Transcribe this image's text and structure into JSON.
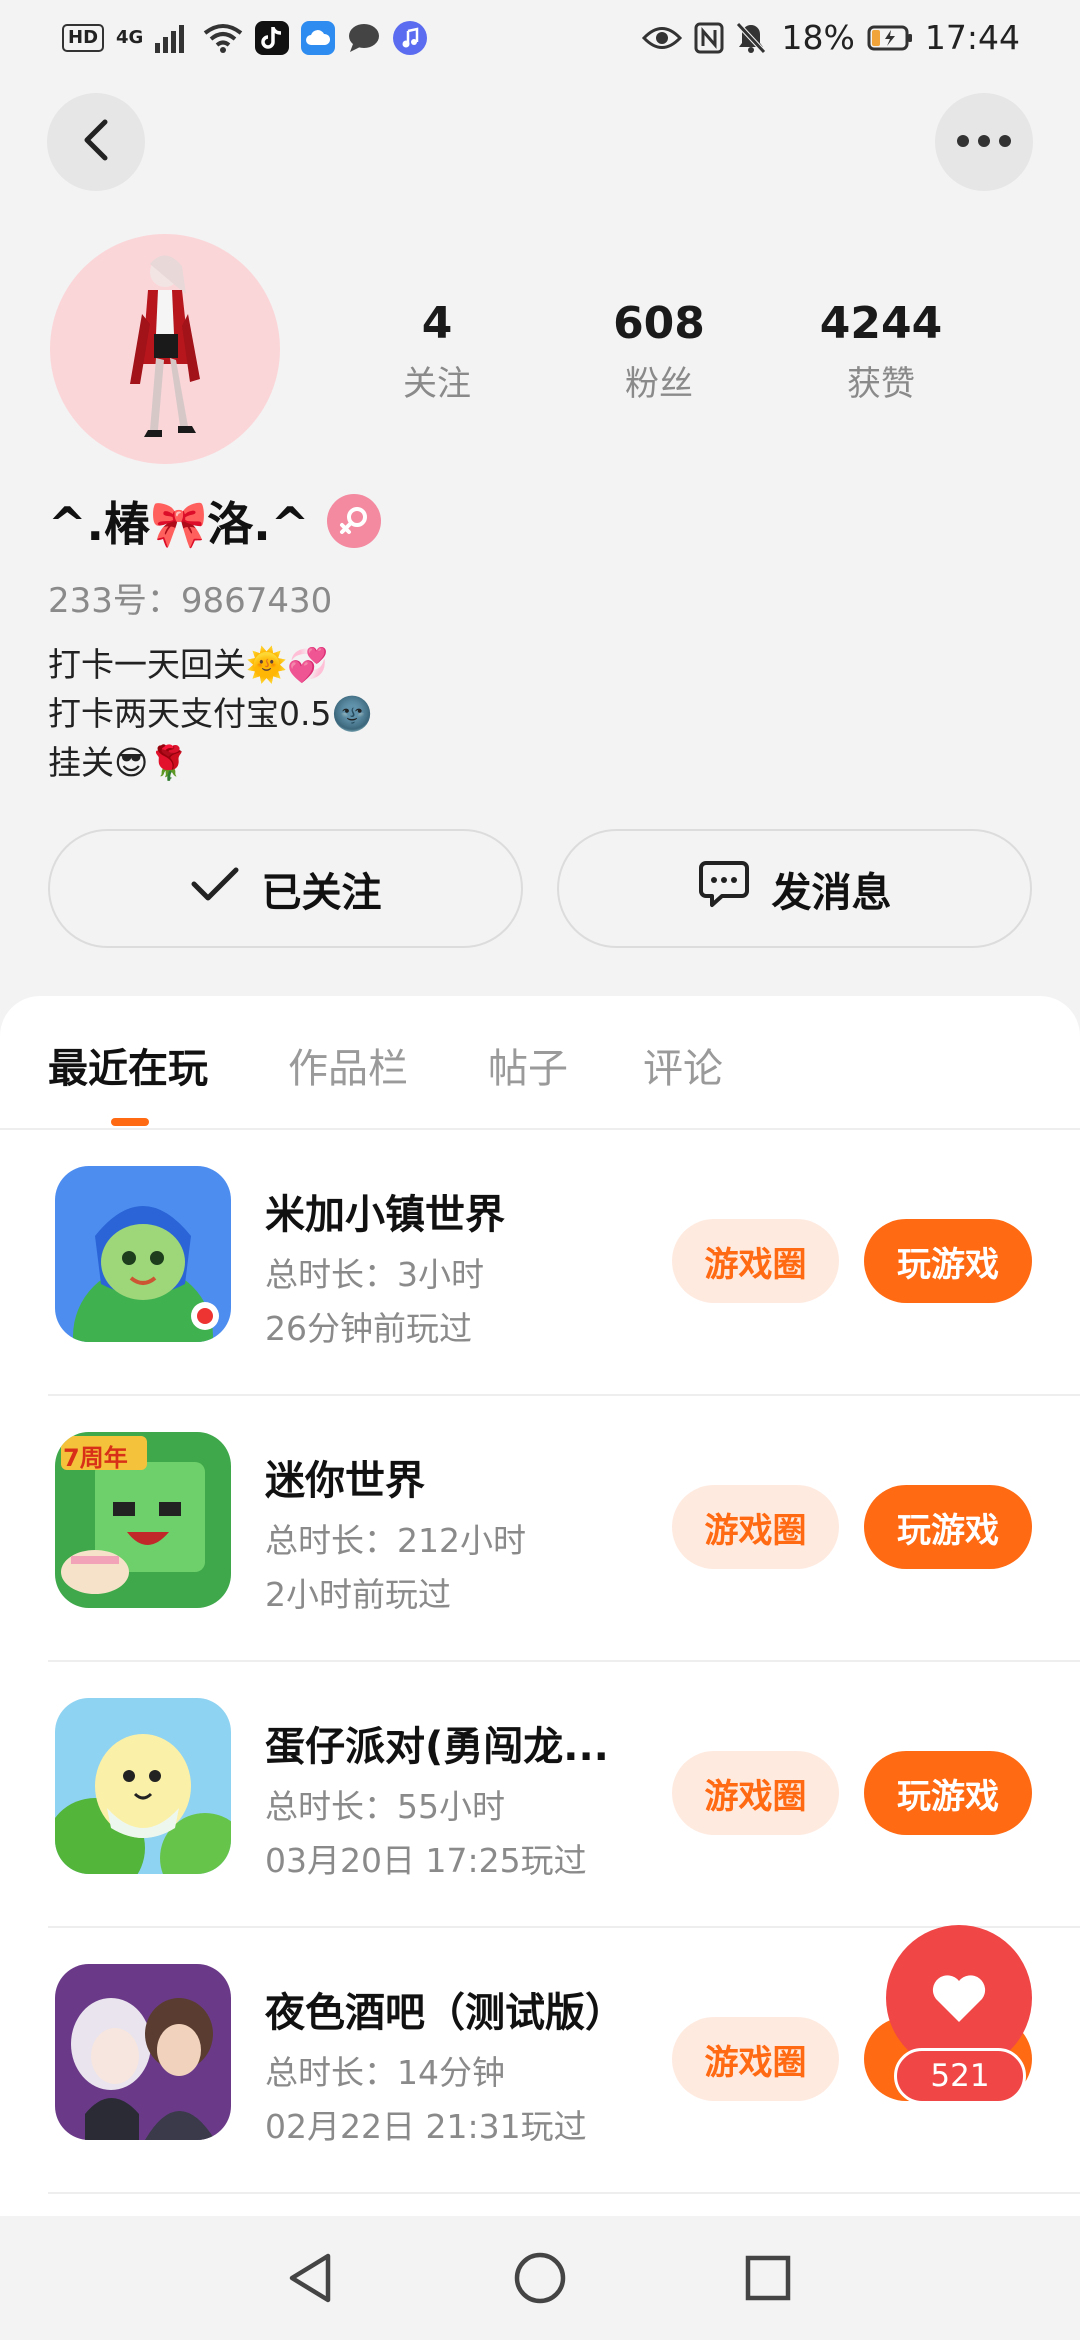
{
  "status_bar": {
    "hd": "HD",
    "network": "4G",
    "battery_percent": "18%",
    "time": "17:44",
    "icons": [
      "signal-icon",
      "wifi-icon",
      "tiktok-icon",
      "cloud-icon",
      "chat-icon",
      "music-icon",
      "eye-icon",
      "nfc-icon",
      "mute-icon",
      "battery-icon"
    ]
  },
  "profile": {
    "stats": [
      {
        "value": "4",
        "label": "关注"
      },
      {
        "value": "608",
        "label": "粉丝"
      },
      {
        "value": "4244",
        "label": "获赞"
      }
    ],
    "nickname": "^.椿🎀洛.^",
    "gender": "female",
    "uid": "233号：9867430",
    "bio": [
      "打卡一天回关🌞💞",
      "打卡两天支付宝0.5🌚",
      "挂关😎🌹"
    ]
  },
  "actions": {
    "follow_label": "已关注",
    "message_label": "发消息"
  },
  "tabs": [
    "最近在玩",
    "作品栏",
    "帖子",
    "评论"
  ],
  "active_tab": 0,
  "games": [
    {
      "name": "米加小镇世界",
      "duration": "总时长：3小时",
      "last_played": "26分钟前玩过",
      "circle_label": "游戏圈",
      "play_label": "玩游戏"
    },
    {
      "name": "迷你世界",
      "duration": "总时长：212小时",
      "last_played": "2小时前玩过",
      "circle_label": "游戏圈",
      "play_label": "玩游戏"
    },
    {
      "name": "蛋仔派对(勇闯龙...",
      "duration": "总时长：55小时",
      "last_played": "03月20日 17:25玩过",
      "circle_label": "游戏圈",
      "play_label": "玩游戏"
    },
    {
      "name": "夜色酒吧（测试版）",
      "duration": "总时长：14分钟",
      "last_played": "02月22日 21:31玩过",
      "circle_label": "游戏圈",
      "play_label": ""
    }
  ],
  "game_icon_badges": [
    "7周年"
  ],
  "floating_like": {
    "count": "521"
  },
  "colors": {
    "accent": "#ff6a13",
    "accent_light": "#ffeae0",
    "like_red": "#f04646",
    "gender_pink": "#f38aa0"
  }
}
